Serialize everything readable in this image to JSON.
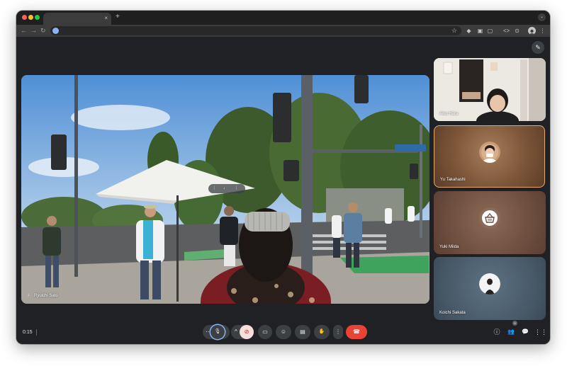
{
  "browser": {
    "tab_close": "×",
    "tab_new": "+",
    "tab_search_icon": "⌄",
    "nav": {
      "back": "←",
      "forward": "→",
      "reload": "↻"
    },
    "star": "☆",
    "toolbar_icons": [
      "◆",
      "▣",
      "▢",
      "<>",
      "⊙",
      "⋮"
    ]
  },
  "meet": {
    "effects_icon": "✎",
    "main_tile": {
      "name": "Ryuichi Sato",
      "mic_icon": "♩",
      "menu": "⋮ ♩ ⋮"
    },
    "participants": [
      {
        "name": "Aiko Hara",
        "state": "video"
      },
      {
        "name": "Yu Takahashi",
        "state": "speaking",
        "highlight": "#e6a968"
      },
      {
        "name": "Yuki Miida",
        "state": "avatar"
      },
      {
        "name": "Koichi Sakata",
        "state": "avatar"
      }
    ],
    "clock": "0:15",
    "controls": {
      "more_options": "⋯",
      "mic": "🎙",
      "camera_chevron": "^",
      "camera_off": "⊘",
      "present": "▭",
      "emoji": "☺",
      "captions": "▤",
      "raise_hand": "✋",
      "more": "⋮",
      "end_call": "☎"
    },
    "right_icons": {
      "info": "ⓘ",
      "people": "👥",
      "chat": "💬",
      "activities": "⋮⋮"
    },
    "people_count": "5",
    "colors": {
      "end_call": "#ea4335",
      "camera_off_bg": "#f9dedc",
      "active_speaker": "#e6a968"
    }
  }
}
